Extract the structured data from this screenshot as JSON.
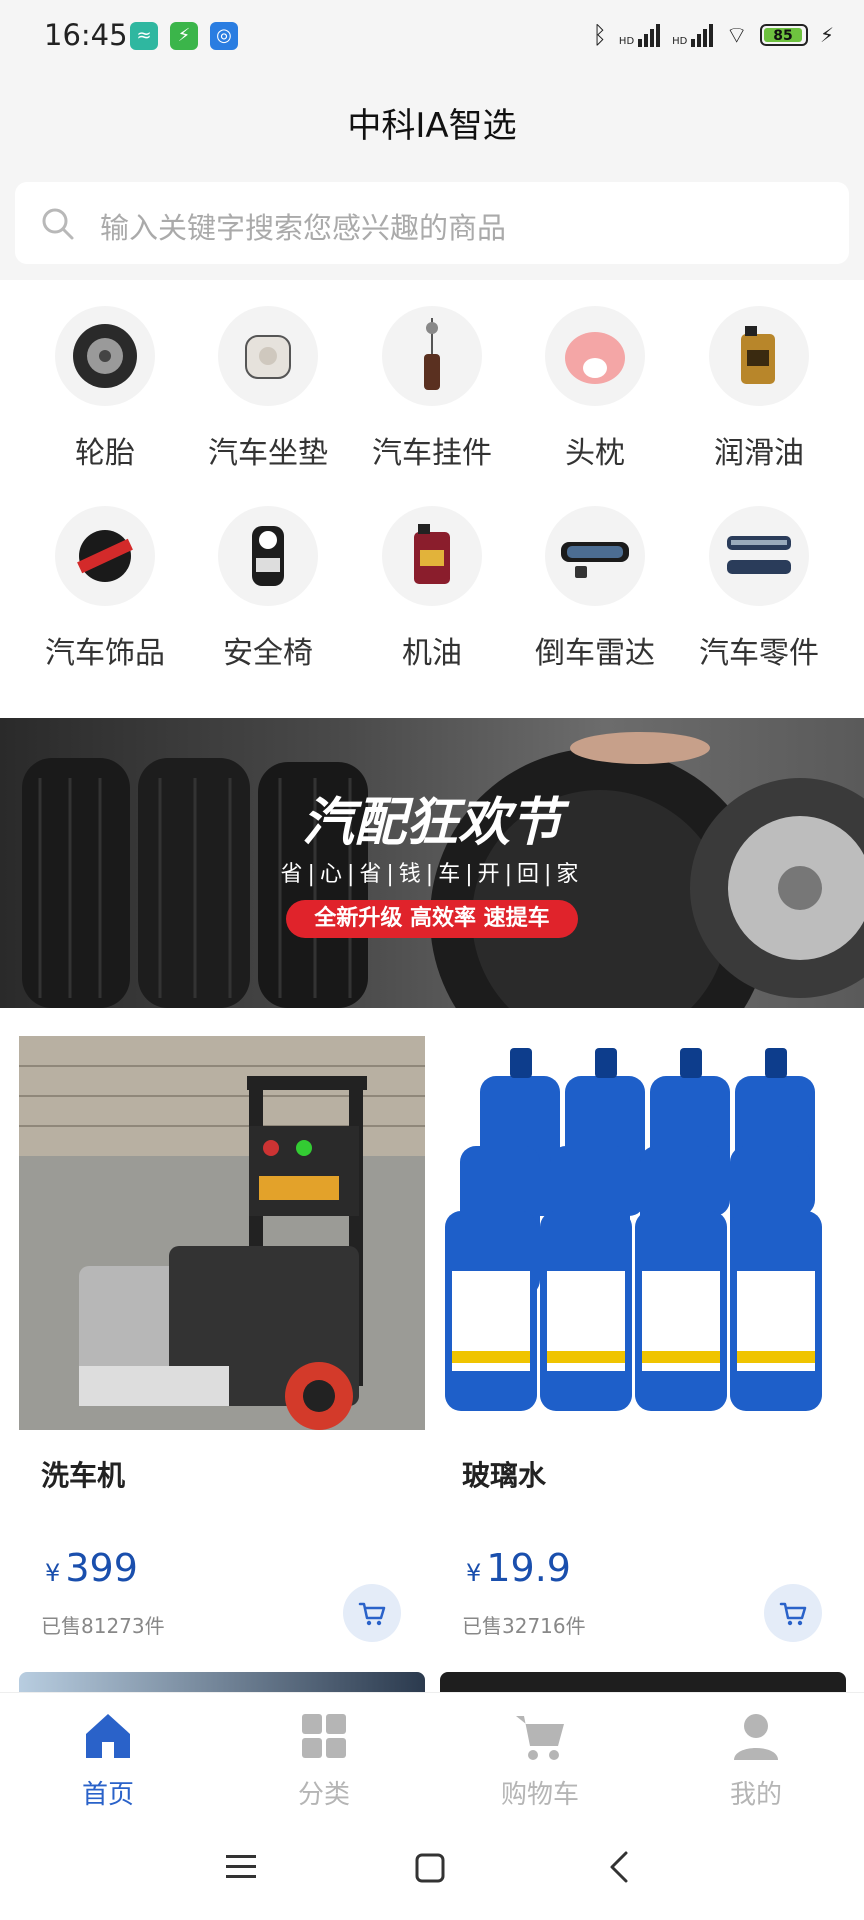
{
  "status_bar": {
    "time": "16:45",
    "battery": "85",
    "hd1": "HD",
    "hd2": "HD"
  },
  "header": {
    "title": "中科IA智选"
  },
  "search": {
    "placeholder": "输入关键字搜索您感兴趣的商品"
  },
  "categories": [
    {
      "label": "轮胎",
      "icon": "tire-icon"
    },
    {
      "label": "汽车坐垫",
      "icon": "seat-cushion-icon"
    },
    {
      "label": "汽车挂件",
      "icon": "car-pendant-icon"
    },
    {
      "label": "头枕",
      "icon": "headrest-icon"
    },
    {
      "label": "润滑油",
      "icon": "lubricant-icon"
    },
    {
      "label": "汽车饰品",
      "icon": "car-accessory-icon"
    },
    {
      "label": "安全椅",
      "icon": "safety-seat-icon"
    },
    {
      "label": "机油",
      "icon": "engine-oil-icon"
    },
    {
      "label": "倒车雷达",
      "icon": "reverse-radar-icon"
    },
    {
      "label": "汽车零件",
      "icon": "car-parts-icon"
    }
  ],
  "banner": {
    "title": "汽配狂欢节",
    "subtitle": "省|心|省|钱|车|开|回|家",
    "tag": "全新升级 高效率 速提车"
  },
  "products": [
    {
      "name": "洗车机",
      "currency": "¥",
      "price": "399",
      "sold": "已售81273件"
    },
    {
      "name": "玻璃水",
      "currency": "¥",
      "price": "19.9",
      "sold": "已售32716件"
    }
  ],
  "tabs": [
    {
      "label": "首页",
      "active": true
    },
    {
      "label": "分类",
      "active": false
    },
    {
      "label": "购物车",
      "active": false
    },
    {
      "label": "我的",
      "active": false
    }
  ],
  "colors": {
    "accent": "#1a4fad",
    "tab_active": "#2a62c9",
    "tab_inactive": "#b5b5b5",
    "banner_tag": "#e0232b"
  }
}
